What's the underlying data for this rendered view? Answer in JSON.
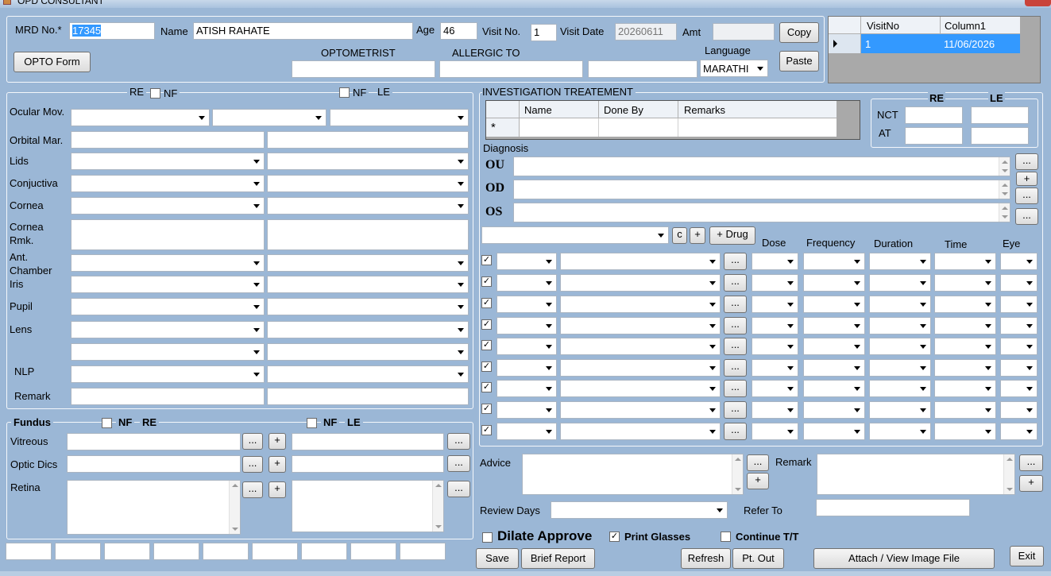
{
  "window": {
    "title": "OPD CONSULTANT"
  },
  "header": {
    "mrd_label": "MRD No.*",
    "mrd_value": "17345",
    "name_label": "Name",
    "name_value": "ATISH  RAHATE",
    "age_label": "Age",
    "age_value": "46",
    "visitno_label": "Visit No.",
    "visitno_value": "1",
    "visitdate_label": "Visit Date",
    "visitdate_value": "20260611",
    "amt_label": "Amt",
    "amt_value": "",
    "copy_label": "Copy",
    "paste_label": "Paste",
    "opto_form_label": "OPTO Form",
    "optometrist_label": "OPTOMETRIST",
    "allergic_label": "ALLERGIC TO",
    "language_label": "Language",
    "language_value": "MARATHI"
  },
  "visit_grid": {
    "columns": [
      "VisitNo",
      "Column1"
    ],
    "rows": [
      {
        "visitno": "1",
        "column1": "11/06/2026"
      }
    ]
  },
  "exam": {
    "re_label": "RE",
    "le_label": "LE",
    "nf_label": "NF",
    "rows": [
      "Ocular Mov.",
      "Orbital Mar.",
      "Lids",
      "Conjuctiva",
      "Cornea",
      "Cornea Rmk.",
      "Ant. Chamber",
      "Iris",
      "Pupil",
      "Lens",
      "",
      "NLP",
      "Remark"
    ]
  },
  "fundus": {
    "title": "Fundus",
    "nf_label": "NF",
    "re_label": "RE",
    "le_label": "LE",
    "vitreous": "Vitreous",
    "optic": "Optic Dics",
    "retina": "Retina"
  },
  "investigation": {
    "title": "INVESTIGATION TREATEMENT",
    "columns": [
      "Name",
      "Done By",
      "Remarks"
    ],
    "new_row_marker": "*"
  },
  "nct": {
    "re": "RE",
    "le": "LE",
    "nct": "NCT",
    "at": "AT"
  },
  "diagnosis": {
    "label": "Diagnosis",
    "ou": "OU",
    "od": "OD",
    "os": "OS"
  },
  "drugs": {
    "c_label": "c",
    "plus_label": "+",
    "drug_label": "+ Drug",
    "columns": [
      "Dose",
      "Frequency",
      "Duration",
      "Time",
      "Eye"
    ],
    "row_check": "✓",
    "rows": 9
  },
  "advice": {
    "label": "Advice",
    "remark_label": "Remark",
    "review_label": "Review Days",
    "refer_label": "Refer To"
  },
  "options": {
    "dilate": "Dilate Approve",
    "print_glasses": "Print Glasses",
    "continue": "Continue T/T"
  },
  "footer": {
    "save": "Save",
    "brief": "Brief Report",
    "refresh": "Refresh",
    "ptout": "Pt. Out",
    "attach": "Attach / View Image File",
    "exit": "Exit"
  },
  "small_buttons": {
    "ellipsis": "...",
    "plus": "+"
  }
}
